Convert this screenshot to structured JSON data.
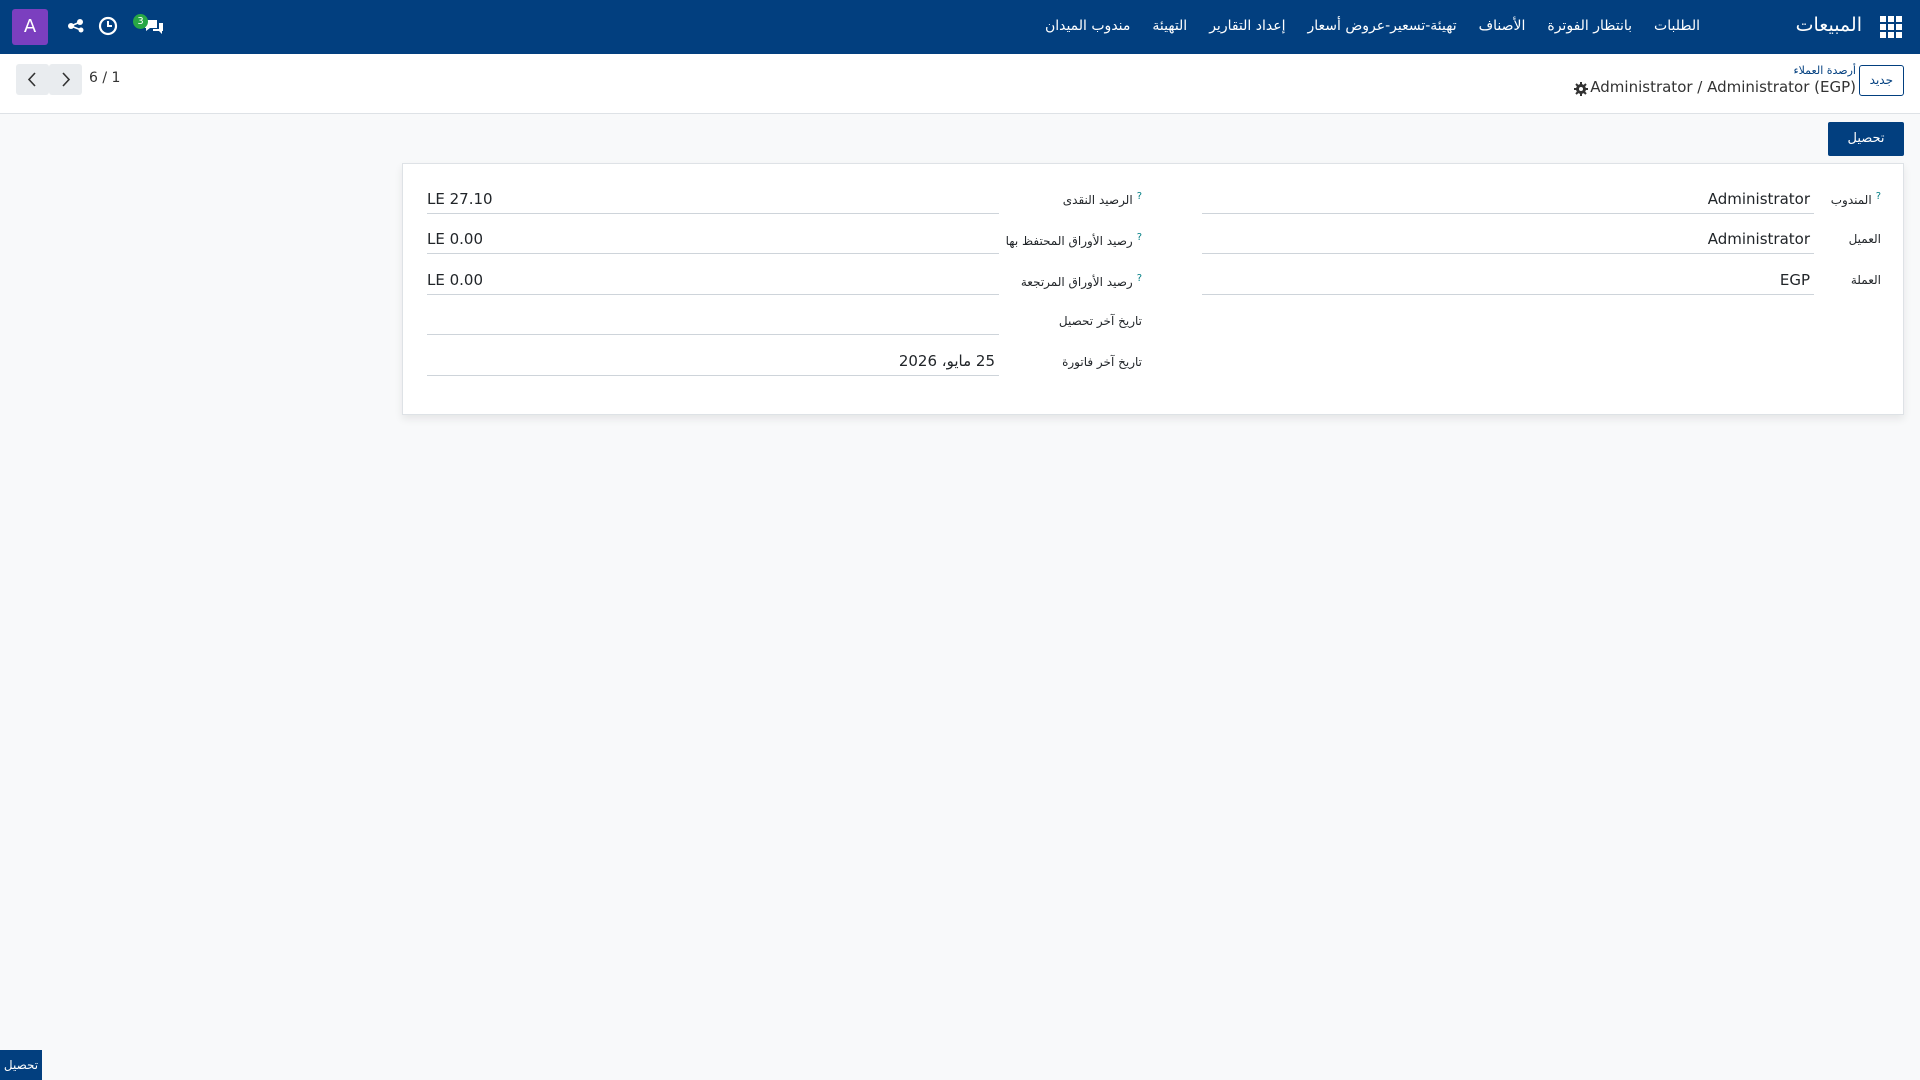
{
  "navbar": {
    "brand": "المبيعات",
    "menu": [
      "الطلبات",
      "بانتظار الفوترة",
      "الأصناف",
      "تهيئة-تسعير-عروض أسعار",
      "إعداد التقارير",
      "التهيئة",
      "مندوب الميدان"
    ],
    "chat_count": "3",
    "avatar_letter": "A"
  },
  "control_panel": {
    "new_label": "جديد",
    "breadcrumb_parent": "أرصدة العملاء",
    "breadcrumb_current": "Administrator / Administrator (EGP)",
    "pager": "6 / 1"
  },
  "status_bar": {
    "collect_label": "تحصيل"
  },
  "form": {
    "right": [
      {
        "label": "المندوب",
        "help": "?",
        "value": "Administrator"
      },
      {
        "label": "العميل",
        "help": "",
        "value": "Administrator"
      },
      {
        "label": "العملة",
        "help": "",
        "value": "EGP"
      }
    ],
    "left": [
      {
        "label": "الرصيد النقدى",
        "help": "?",
        "value": "LE 27.10"
      },
      {
        "label": "رصيد الأوراق المحتفظ بها",
        "help": "?",
        "value": "LE 0.00"
      },
      {
        "label": "رصيد الأوراق المرتجعة",
        "help": "?",
        "value": "LE 0.00"
      },
      {
        "label": "تاريخ آخر تحصيل",
        "help": "",
        "value": ""
      },
      {
        "label": "تاريخ آخر فاتورة",
        "help": "",
        "value": "25 مايو، 2026"
      }
    ]
  },
  "bottom_button": {
    "label": "تحصيل"
  }
}
